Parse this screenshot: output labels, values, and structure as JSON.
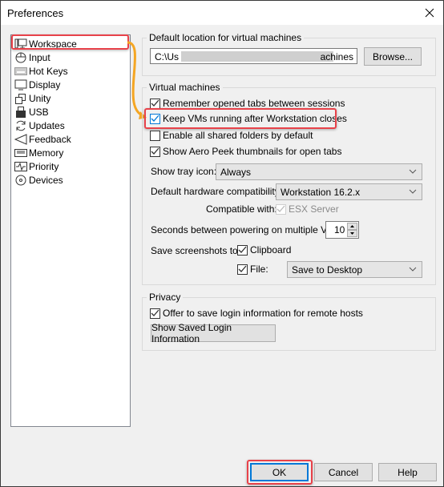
{
  "window": {
    "title": "Preferences"
  },
  "sidebar": {
    "items": [
      {
        "label": "Workspace",
        "icon": "workspace-icon",
        "selected": true
      },
      {
        "label": "Input",
        "icon": "mouse-icon"
      },
      {
        "label": "Hot Keys",
        "icon": "keyboard-icon"
      },
      {
        "label": "Display",
        "icon": "monitor-icon"
      },
      {
        "label": "Unity",
        "icon": "unity-windows-icon"
      },
      {
        "label": "USB",
        "icon": "usb-icon"
      },
      {
        "label": "Updates",
        "icon": "refresh-icon"
      },
      {
        "label": "Feedback",
        "icon": "megaphone-icon"
      },
      {
        "label": "Memory",
        "icon": "memory-icon"
      },
      {
        "label": "Priority",
        "icon": "pulse-icon"
      },
      {
        "label": "Devices",
        "icon": "disc-icon"
      }
    ]
  },
  "default_location": {
    "group_label": "Default location for virtual machines",
    "path_start": "C:\\Us",
    "path_end": "achines",
    "browse_label": "Browse..."
  },
  "virtual_machines": {
    "group_label": "Virtual machines",
    "checkboxes": [
      {
        "label": "Remember opened tabs between sessions",
        "checked": true
      },
      {
        "label": "Keep VMs running after Workstation closes",
        "checked": true
      },
      {
        "label": "Enable all shared folders by default",
        "checked": false
      },
      {
        "label": "Show Aero Peek thumbnails for open tabs",
        "checked": true
      }
    ],
    "tray_icon_label": "Show tray icon:",
    "tray_icon_value": "Always",
    "hw_compat_label": "Default hardware compatibility:",
    "hw_compat_value": "Workstation 16.2.x",
    "compatible_with_label": "Compatible with:",
    "compatible_with_value": "ESX Server",
    "compatible_with_checked": true,
    "seconds_label": "Seconds between powering on multiple VMs:",
    "seconds_value": "10",
    "screenshots_label": "Save screenshots to:",
    "clipboard_label": "Clipboard",
    "clipboard_checked": true,
    "file_label": "File:",
    "file_checked": true,
    "file_target": "Save to Desktop"
  },
  "privacy": {
    "group_label": "Privacy",
    "offer_save_label": "Offer to save login information for remote hosts",
    "offer_save_checked": true,
    "show_saved_label": "Show Saved Login Information"
  },
  "footer": {
    "ok_label": "OK",
    "cancel_label": "Cancel",
    "help_label": "Help"
  },
  "annotation": {
    "highlight_color": "#e8424a",
    "arrow_color": "#f5a623"
  }
}
